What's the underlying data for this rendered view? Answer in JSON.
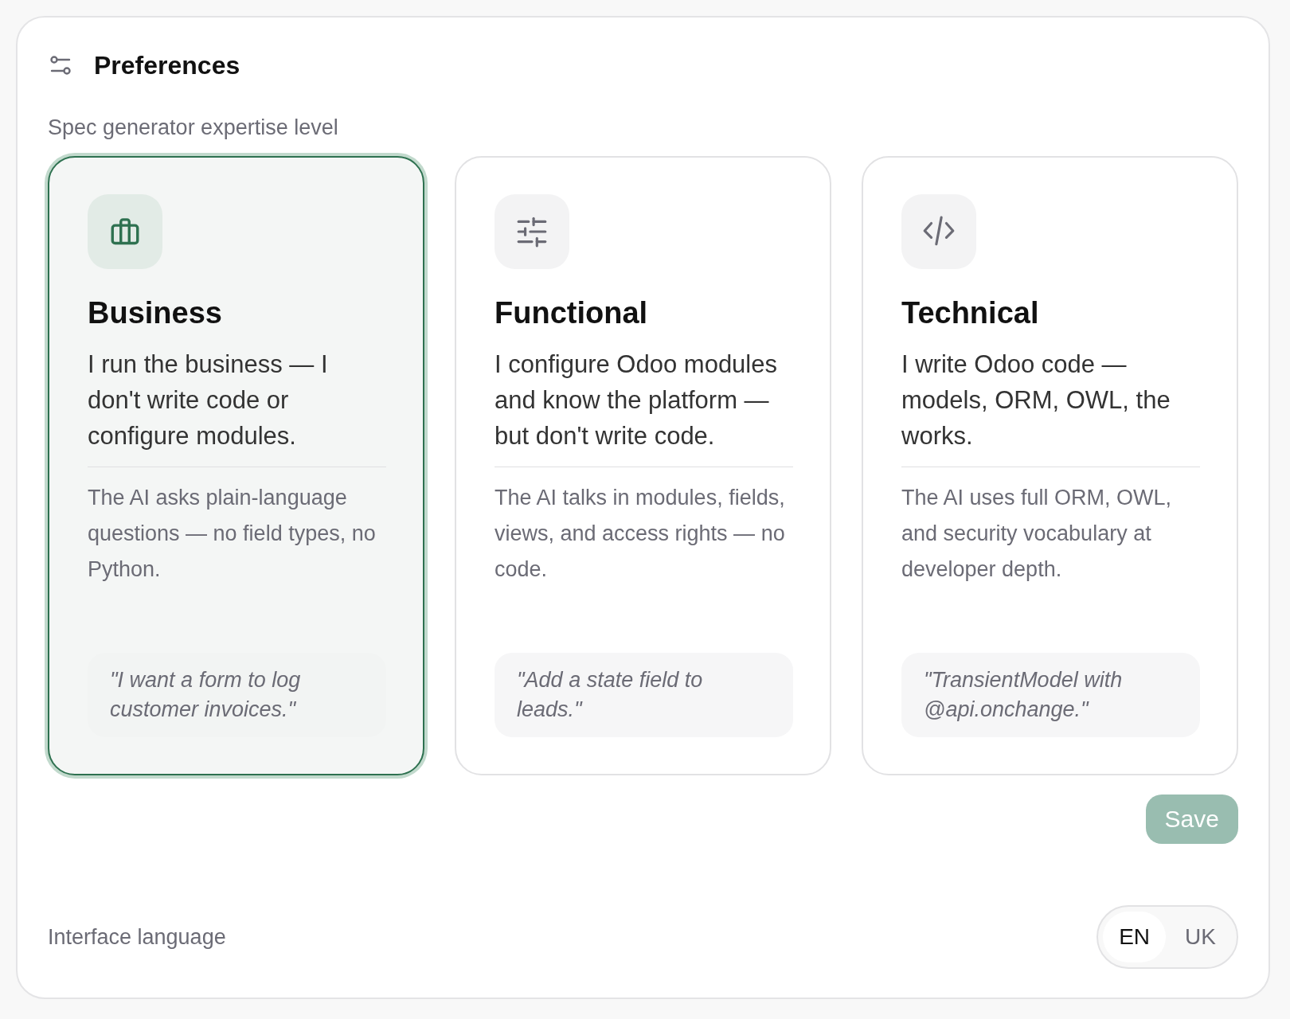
{
  "panel": {
    "title": "Preferences"
  },
  "expertise": {
    "label": "Spec generator expertise level",
    "options": [
      {
        "kind": "business",
        "title": "Business",
        "description": "I run the business — I don't write code or configure modules.",
        "detail": "The AI asks plain-language questions — no field types, no Python.",
        "example": "\"I want a form to log customer invoices.\"",
        "selected": true
      },
      {
        "kind": "functional",
        "title": "Functional",
        "description": "I configure Odoo modules and know the platform — but don't write code.",
        "detail": "The AI talks in modules, fields, views, and access rights — no code.",
        "example": "\"Add a state field to leads.\"",
        "selected": false
      },
      {
        "kind": "technical",
        "title": "Technical",
        "description": "I write Odoo code — models, ORM, OWL, the works.",
        "detail": "The AI uses full ORM, OWL, and security vocabulary at developer depth.",
        "example": "\"TransientModel with @api.onchange.\"",
        "selected": false
      }
    ]
  },
  "save_button": {
    "label": "Save",
    "disabled": true
  },
  "language": {
    "label": "Interface language",
    "options": [
      {
        "label": "EN",
        "selected": true
      },
      {
        "label": "UK",
        "selected": false
      }
    ]
  }
}
